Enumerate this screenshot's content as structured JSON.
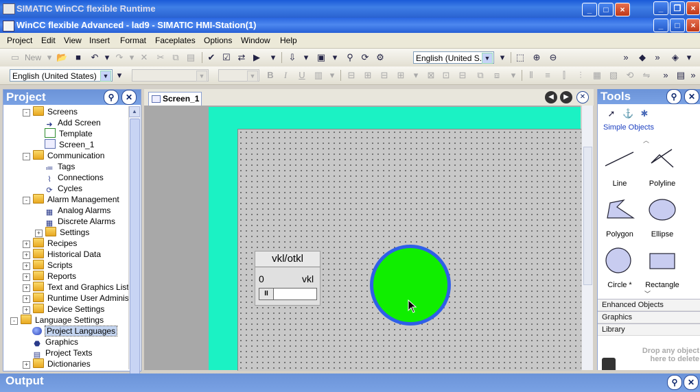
{
  "runtime_window": {
    "title": "SIMATIC WinCC flexible Runtime"
  },
  "main_window": {
    "title": "WinCC flexible Advanced - lad9 - SIMATIC HMI-Station(1)"
  },
  "menu": [
    "Project",
    "Edit",
    "View",
    "Insert",
    "Format",
    "Faceplates",
    "Options",
    "Window",
    "Help"
  ],
  "toolbar1": {
    "new_label": "New",
    "language_combo": "English (United S..."
  },
  "toolbar2": {
    "language_combo": "English (United States)"
  },
  "project_panel": {
    "title": "Project",
    "tree": [
      {
        "label": "Screens",
        "icon": "folder-icon",
        "indent": 1,
        "expander": "-"
      },
      {
        "label": "Add Screen",
        "icon": "add-screen-icon",
        "indent": 2
      },
      {
        "label": "Template",
        "icon": "template-icon",
        "indent": 2
      },
      {
        "label": "Screen_1",
        "icon": "screen-icon",
        "indent": 2
      },
      {
        "label": "Communication",
        "icon": "folder-icon",
        "indent": 1,
        "expander": "-"
      },
      {
        "label": "Tags",
        "icon": "tags-icon",
        "indent": 2
      },
      {
        "label": "Connections",
        "icon": "connections-icon",
        "indent": 2
      },
      {
        "label": "Cycles",
        "icon": "cycles-icon",
        "indent": 2
      },
      {
        "label": "Alarm Management",
        "icon": "folder-icon",
        "indent": 1,
        "expander": "-"
      },
      {
        "label": "Analog Alarms",
        "icon": "analog-alarms-icon",
        "indent": 2
      },
      {
        "label": "Discrete Alarms",
        "icon": "discrete-alarms-icon",
        "indent": 2
      },
      {
        "label": "Settings",
        "icon": "folder-icon",
        "indent": 2,
        "expander": "+"
      },
      {
        "label": "Recipes",
        "icon": "folder-icon",
        "indent": 1,
        "expander": "+"
      },
      {
        "label": "Historical Data",
        "icon": "folder-icon",
        "indent": 1,
        "expander": "+"
      },
      {
        "label": "Scripts",
        "icon": "folder-icon",
        "indent": 1,
        "expander": "+"
      },
      {
        "label": "Reports",
        "icon": "folder-icon",
        "indent": 1,
        "expander": "+"
      },
      {
        "label": "Text and Graphics Lists",
        "icon": "folder-icon",
        "indent": 1,
        "expander": "+"
      },
      {
        "label": "Runtime User Administrat",
        "icon": "folder-icon",
        "indent": 1,
        "expander": "+"
      },
      {
        "label": "Device Settings",
        "icon": "folder-icon",
        "indent": 1,
        "expander": "+"
      },
      {
        "label": "Language Settings",
        "icon": "folder-icon",
        "indent": 0,
        "expander": "-"
      },
      {
        "label": "Project Languages",
        "icon": "globe-icon",
        "indent": 1,
        "selected": true
      },
      {
        "label": "Graphics",
        "icon": "graphics-icon",
        "indent": 1
      },
      {
        "label": "Project Texts",
        "icon": "project-texts-icon",
        "indent": 1
      },
      {
        "label": "Dictionaries",
        "icon": "folder-icon",
        "indent": 1,
        "expander": "+"
      }
    ]
  },
  "editor": {
    "tab_label": "Screen_1",
    "switch_widget": {
      "title": "vkl/otkl",
      "left_label": "0",
      "right_label": "vkl"
    }
  },
  "tools_panel": {
    "title": "Tools",
    "section": "Simple Objects",
    "objects": [
      "Line",
      "Polyline",
      "Polygon",
      "Ellipse",
      "Circle *",
      "Rectangle"
    ],
    "groups": [
      "Enhanced Objects",
      "Graphics",
      "Library"
    ],
    "library_hint": "Drop any object here to delete"
  },
  "output_panel": {
    "title": "Output"
  },
  "colors": {
    "screen_background": "#1bf2c4",
    "circle_fill": "#10ee00",
    "circle_border": "#2f5fe8",
    "title_bar": "#2a66e0"
  }
}
